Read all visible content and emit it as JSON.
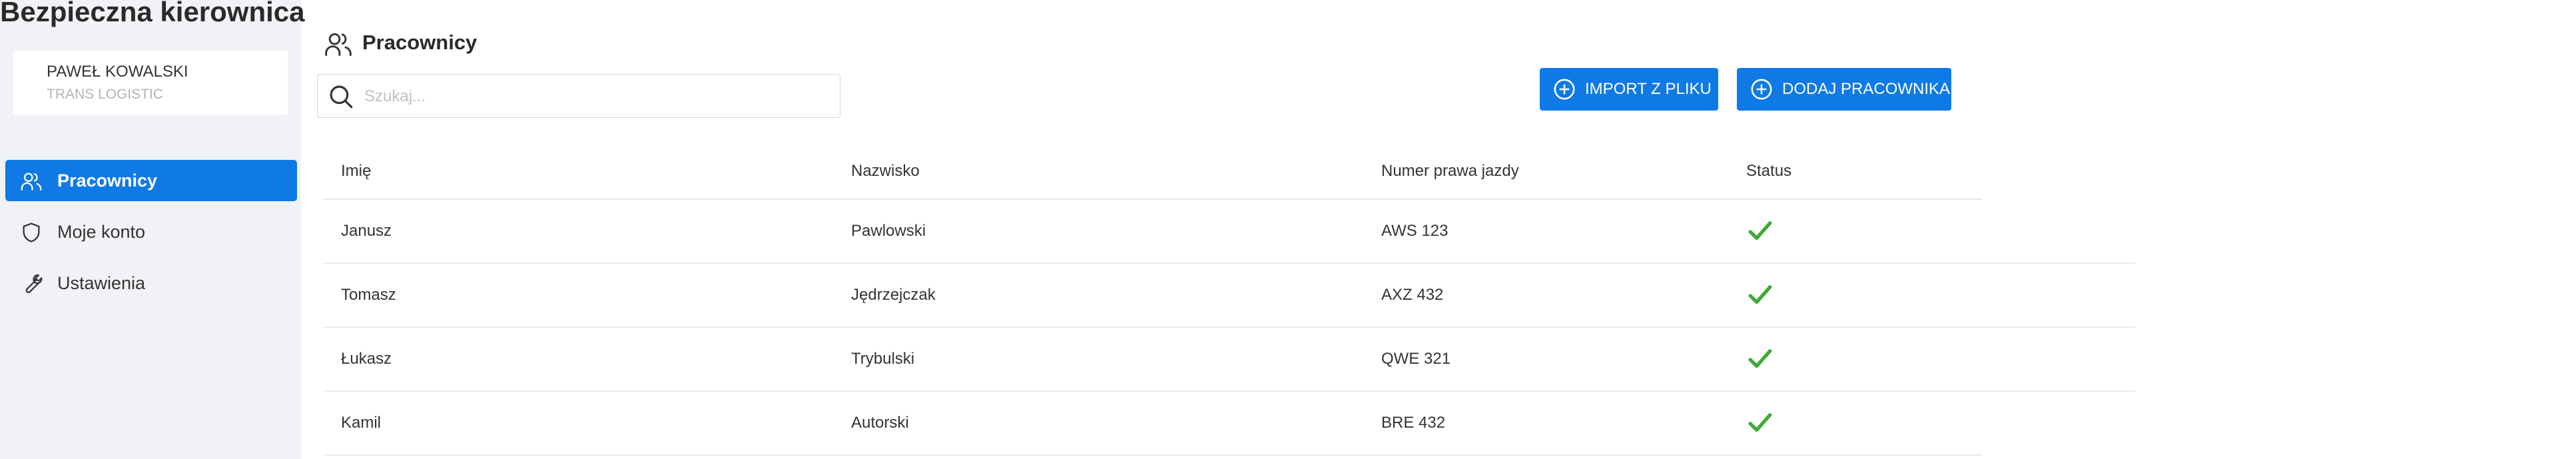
{
  "app": {
    "title": "Bezpieczna kierownica"
  },
  "user": {
    "name": "PAWEŁ KOWALSKI",
    "company": "TRANS LOGISTIC"
  },
  "sidebar": {
    "items": [
      {
        "label": "Pracownicy",
        "icon": "users-icon",
        "active": true
      },
      {
        "label": "Moje konto",
        "icon": "shield-icon",
        "active": false
      },
      {
        "label": "Ustawienia",
        "icon": "wrench-icon",
        "active": false
      }
    ]
  },
  "header": {
    "title": "Pracownicy",
    "icon": "users-icon"
  },
  "search": {
    "placeholder": "Szukaj...",
    "value": ""
  },
  "actions": {
    "import_label": "IMPORT Z PLIKU",
    "add_label": "DODAJ PRACOWNIKA"
  },
  "colors": {
    "accent": "#0f7ae5",
    "status_ok": "#3faa34",
    "sidebar_bg": "#f0f2f5"
  },
  "table": {
    "columns": [
      "Imię",
      "Nazwisko",
      "Numer prawa jazdy",
      "Status"
    ],
    "rows": [
      {
        "first_name": "Janusz",
        "last_name": "Pawlowski",
        "license": "AWS 123",
        "status": "check-icon"
      },
      {
        "first_name": "Tomasz",
        "last_name": "Jędrzejczak",
        "license": "AXZ 432",
        "status": "check-icon"
      },
      {
        "first_name": "Łukasz",
        "last_name": "Trybulski",
        "license": "QWE 321",
        "status": "check-icon"
      },
      {
        "first_name": "Kamil",
        "last_name": "Autorski",
        "license": "BRE 432",
        "status": "check-icon"
      }
    ]
  }
}
